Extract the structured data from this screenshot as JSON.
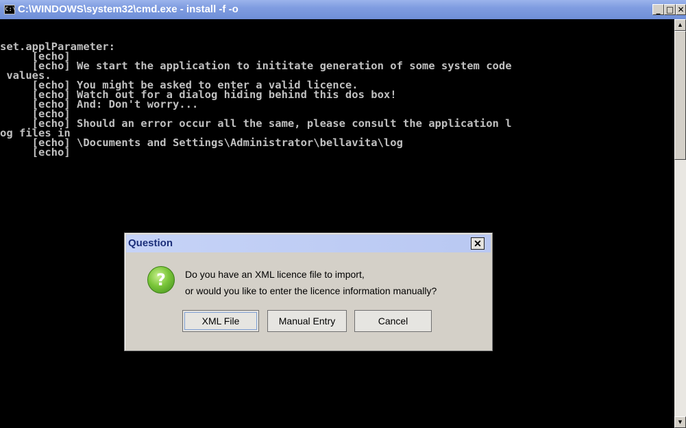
{
  "window": {
    "title": "C:\\WINDOWS\\system32\\cmd.exe - install -f -o",
    "icon_label": "C:\\",
    "controls": {
      "minimize_symbol": "_",
      "maximize_symbol": "□",
      "close_symbol": "✕"
    }
  },
  "console": {
    "lines": [
      "set.applParameter:",
      "     [echo]",
      "     [echo] We start the application to inititate generation of some system code",
      " values.",
      "     [echo] You might be asked to enter a valid licence.",
      "     [echo] Watch out for a dialog hiding behind this dos box!",
      "     [echo] And: Don't worry...",
      "     [echo]",
      "     [echo] Should an error occur all the same, please consult the application l",
      "og files in",
      "     [echo] \\Documents and Settings\\Administrator\\bellavita\\log",
      "     [echo]"
    ]
  },
  "scrollbar": {
    "up_symbol": "▲",
    "down_symbol": "▼"
  },
  "dialog": {
    "title": "Question",
    "close_symbol": "✕",
    "icon_glyph": "?",
    "message_line1": "Do you have an XML licence file to import,",
    "message_line2": "or would you like to enter the licence information manually?",
    "buttons": {
      "xml_file": "XML File",
      "manual_entry": "Manual Entry",
      "cancel": "Cancel"
    }
  }
}
